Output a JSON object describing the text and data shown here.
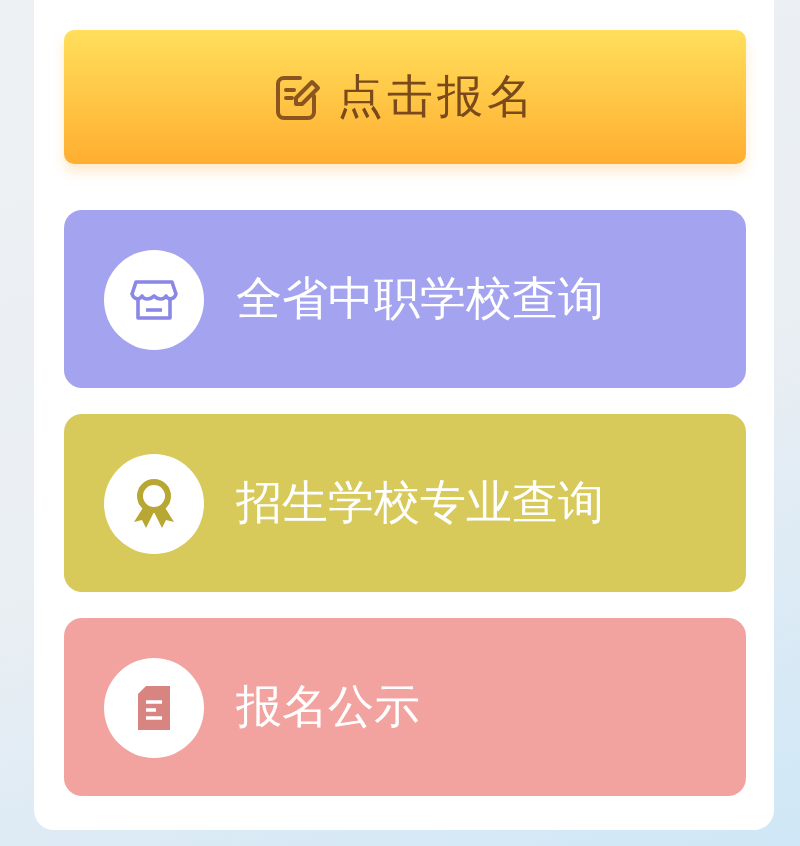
{
  "signup_button": {
    "label": "点击报名"
  },
  "menu": [
    {
      "label": "全省中职学校查询",
      "kind": "store",
      "color": "#a3a3f0"
    },
    {
      "label": "招生学校专业查询",
      "kind": "award",
      "color": "#d7c95a"
    },
    {
      "label": "报名公示",
      "kind": "document",
      "color": "#f2a3a0"
    }
  ]
}
